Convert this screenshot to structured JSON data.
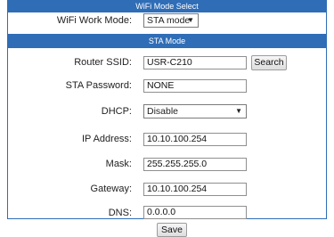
{
  "wifi_mode_select": {
    "header": "WiFi Mode Select",
    "work_mode_label": "WiFi Work Mode:",
    "work_mode_value": "STA mode"
  },
  "sta_mode": {
    "header": "STA Mode",
    "router_ssid_label": "Router SSID:",
    "router_ssid_value": "USR-C210",
    "search_label": "Search",
    "sta_password_label": "STA Password:",
    "sta_password_value": "NONE",
    "dhcp_label": "DHCP:",
    "dhcp_value": "Disable",
    "ip_address_label": "IP Address:",
    "ip_address_value": "10.10.100.254",
    "mask_label": "Mask:",
    "mask_value": "255.255.255.0",
    "gateway_label": "Gateway:",
    "gateway_value": "10.10.100.254",
    "dns_label": "DNS:",
    "dns_value": "0.0.0.0"
  },
  "footer": {
    "save_label": "Save"
  },
  "icons": {
    "dropdown_arrow": "▼"
  },
  "colors": {
    "header_bg": "#2f6db6",
    "header_text": "#ffffff"
  }
}
